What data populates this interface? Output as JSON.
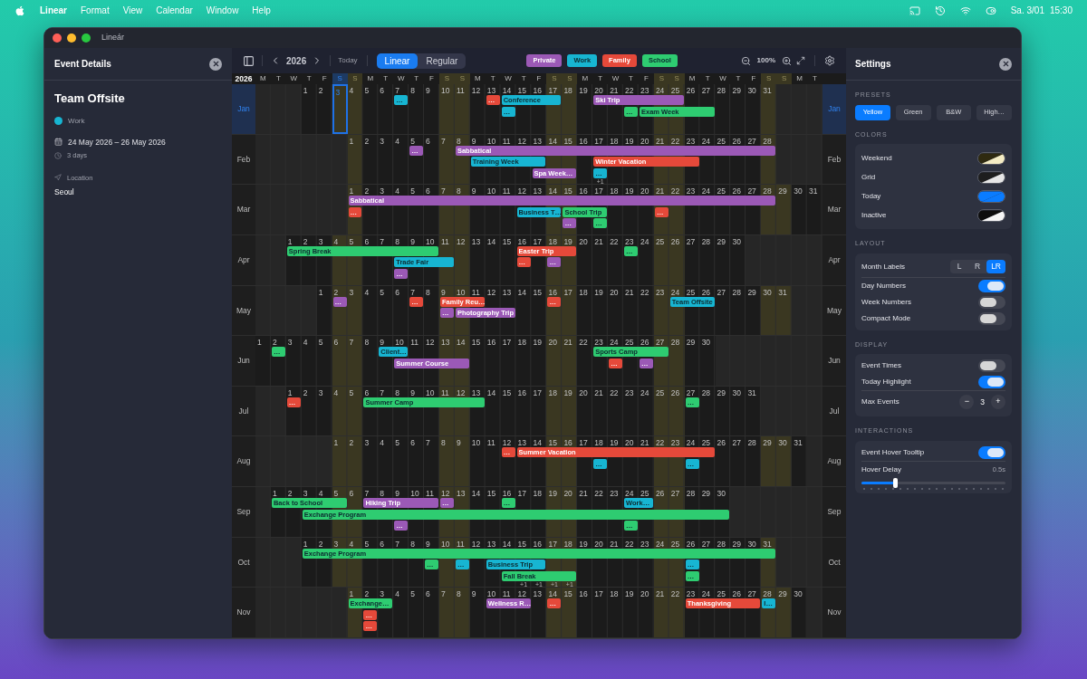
{
  "menu_bar": {
    "app": "Linear",
    "items": [
      "Format",
      "View",
      "Calendar",
      "Window",
      "Help"
    ],
    "date": "Sa. 3/01",
    "time": "15:30"
  },
  "window": {
    "title": "Lineár"
  },
  "event_details": {
    "title": "Event Details",
    "event_title": "Team Offsite",
    "category": {
      "label": "Work",
      "color": "#17b5d2"
    },
    "dates": "24 May 2026 – 26 May 2026",
    "duration": "3 days",
    "location_label": "Location",
    "location": "Seoul"
  },
  "toolbar": {
    "year": "2026",
    "today_button": "Today",
    "views": [
      {
        "label": "Linear",
        "selected": true
      },
      {
        "label": "Regular",
        "selected": false
      }
    ],
    "categories": [
      {
        "label": "Private",
        "color": "#9b59b6"
      },
      {
        "label": "Work",
        "color": "#17b5d2"
      },
      {
        "label": "Family",
        "color": "#e5493a"
      },
      {
        "label": "School",
        "color": "#2ecc71"
      }
    ],
    "zoom": "100%"
  },
  "calendar": {
    "year_label": "2026",
    "weekdays": [
      "M",
      "T",
      "W",
      "T",
      "F",
      "S",
      "S",
      "M",
      "T",
      "W",
      "T",
      "F",
      "S",
      "S",
      "M",
      "T",
      "W",
      "T",
      "F",
      "S",
      "S",
      "M",
      "T",
      "W",
      "T",
      "F",
      "S",
      "S",
      "M",
      "T",
      "W",
      "T",
      "F",
      "S",
      "S",
      "M",
      "T"
    ],
    "months": [
      {
        "label_left": "Jan",
        "label_right": "Jan",
        "selected": true,
        "days": [
          {
            "d": "1",
            "today": false
          },
          {
            "d": "2",
            "today": false
          },
          {
            "d": "3",
            "today": true
          },
          {
            "d": "4",
            "today": false
          },
          {
            "d": "5",
            "today": false
          },
          {
            "d": "6",
            "today": false
          },
          {
            "d": "7",
            "today": false
          },
          {
            "d": "8",
            "today": false
          },
          {
            "d": "9",
            "today": false
          },
          {
            "d": "10",
            "today": false
          },
          {
            "d": "11",
            "today": false
          },
          {
            "d": "12",
            "today": false
          },
          {
            "d": "13",
            "today": false
          },
          {
            "d": "14",
            "today": false
          },
          {
            "d": "15",
            "today": false
          },
          {
            "d": "16",
            "today": false
          },
          {
            "d": "17",
            "today": false
          },
          {
            "d": "18",
            "today": false
          },
          {
            "d": "19",
            "today": false
          },
          {
            "d": "20",
            "today": false
          },
          {
            "d": "21",
            "today": false
          },
          {
            "d": "22",
            "today": false
          },
          {
            "d": "23",
            "today": false
          },
          {
            "d": "24",
            "today": false
          },
          {
            "d": "25",
            "today": false
          },
          {
            "d": "26",
            "today": false
          },
          {
            "d": "27",
            "today": false
          },
          {
            "d": "28",
            "today": false
          },
          {
            "d": "29",
            "today": false
          },
          {
            "d": "30",
            "today": false
          },
          {
            "d": "31",
            "today": false
          }
        ],
        "events": [
          {
            "label": "…",
            "color": "#17b5d2"
          },
          {
            "label": "…",
            "color": "#e5493a"
          },
          {
            "label": "Conference",
            "color": "#17b5d2"
          },
          {
            "label": "…",
            "color": "#17b5d2"
          },
          {
            "label": "Ski Trip",
            "color": "#9b59b6"
          },
          {
            "label": "…",
            "color": "#2ecc71"
          },
          {
            "label": "Exam Week",
            "color": "#2ecc71"
          }
        ]
      },
      {
        "label_left": "Feb",
        "label_right": "Feb",
        "selected": false,
        "days": [
          {
            "d": "1",
            "today": false
          },
          {
            "d": "2",
            "today": false
          },
          {
            "d": "3",
            "today": false
          },
          {
            "d": "4",
            "today": false
          },
          {
            "d": "5",
            "today": false
          },
          {
            "d": "6",
            "today": false
          },
          {
            "d": "7",
            "today": false
          },
          {
            "d": "8",
            "today": false
          },
          {
            "d": "9",
            "today": false
          },
          {
            "d": "10",
            "today": false
          },
          {
            "d": "11",
            "today": false
          },
          {
            "d": "12",
            "today": false
          },
          {
            "d": "13",
            "today": false
          },
          {
            "d": "14",
            "today": false
          },
          {
            "d": "15",
            "today": false
          },
          {
            "d": "16",
            "today": false
          },
          {
            "d": "17",
            "today": false,
            "more": "+1"
          },
          {
            "d": "18",
            "today": false
          },
          {
            "d": "19",
            "today": false
          },
          {
            "d": "20",
            "today": false
          },
          {
            "d": "21",
            "today": false
          },
          {
            "d": "22",
            "today": false
          },
          {
            "d": "23",
            "today": false
          },
          {
            "d": "24",
            "today": false
          },
          {
            "d": "25",
            "today": false
          },
          {
            "d": "26",
            "today": false
          },
          {
            "d": "27",
            "today": false
          },
          {
            "d": "28",
            "today": false
          }
        ],
        "events": [
          {
            "label": "…",
            "color": "#9b59b6"
          },
          {
            "label": "Sabbatical",
            "color": "#9b59b6"
          },
          {
            "label": "Training Week",
            "color": "#17b5d2"
          },
          {
            "label": "Spa Week…",
            "color": "#9b59b6"
          },
          {
            "label": "Winter Vacation",
            "color": "#e5493a"
          },
          {
            "label": "…",
            "color": "#17b5d2"
          }
        ]
      },
      {
        "label_left": "Mar",
        "label_right": "Mar",
        "selected": false,
        "days": [
          {
            "d": "1",
            "today": false
          },
          {
            "d": "2",
            "today": false
          },
          {
            "d": "3",
            "today": false
          },
          {
            "d": "4",
            "today": false
          },
          {
            "d": "5",
            "today": false
          },
          {
            "d": "6",
            "today": false
          },
          {
            "d": "7",
            "today": false
          },
          {
            "d": "8",
            "today": false
          },
          {
            "d": "9",
            "today": false
          },
          {
            "d": "10",
            "today": false
          },
          {
            "d": "11",
            "today": false
          },
          {
            "d": "12",
            "today": false
          },
          {
            "d": "13",
            "today": false
          },
          {
            "d": "14",
            "today": false
          },
          {
            "d": "15",
            "today": false
          },
          {
            "d": "16",
            "today": false
          },
          {
            "d": "17",
            "today": false
          },
          {
            "d": "18",
            "today": false
          },
          {
            "d": "19",
            "today": false
          },
          {
            "d": "20",
            "today": false
          },
          {
            "d": "21",
            "today": false
          },
          {
            "d": "22",
            "today": false
          },
          {
            "d": "23",
            "today": false
          },
          {
            "d": "24",
            "today": false
          },
          {
            "d": "25",
            "today": false
          },
          {
            "d": "26",
            "today": false
          },
          {
            "d": "27",
            "today": false
          },
          {
            "d": "28",
            "today": false
          },
          {
            "d": "29",
            "today": false
          },
          {
            "d": "30",
            "today": false
          },
          {
            "d": "31",
            "today": false
          }
        ],
        "events": [
          {
            "label": "Sabbatical",
            "color": "#9b59b6"
          },
          {
            "label": "…",
            "color": "#e5493a"
          },
          {
            "label": "Business T…",
            "color": "#17b5d2"
          },
          {
            "label": "School Trip",
            "color": "#2ecc71"
          },
          {
            "label": "…",
            "color": "#9b59b6"
          },
          {
            "label": "…",
            "color": "#2ecc71"
          },
          {
            "label": "…",
            "color": "#e5493a"
          }
        ]
      },
      {
        "label_left": "Apr",
        "label_right": "Apr",
        "selected": false,
        "days": [
          {
            "d": "1",
            "today": false
          },
          {
            "d": "2",
            "today": false
          },
          {
            "d": "3",
            "today": false
          },
          {
            "d": "4",
            "today": false
          },
          {
            "d": "5",
            "today": false
          },
          {
            "d": "6",
            "today": false
          },
          {
            "d": "7",
            "today": false
          },
          {
            "d": "8",
            "today": false
          },
          {
            "d": "9",
            "today": false
          },
          {
            "d": "10",
            "today": false
          },
          {
            "d": "11",
            "today": false
          },
          {
            "d": "12",
            "today": false
          },
          {
            "d": "13",
            "today": false
          },
          {
            "d": "14",
            "today": false
          },
          {
            "d": "15",
            "today": false
          },
          {
            "d": "16",
            "today": false
          },
          {
            "d": "17",
            "today": false
          },
          {
            "d": "18",
            "today": false
          },
          {
            "d": "19",
            "today": false
          },
          {
            "d": "20",
            "today": false
          },
          {
            "d": "21",
            "today": false
          },
          {
            "d": "22",
            "today": false
          },
          {
            "d": "23",
            "today": false
          },
          {
            "d": "24",
            "today": false
          },
          {
            "d": "25",
            "today": false
          },
          {
            "d": "26",
            "today": false
          },
          {
            "d": "27",
            "today": false
          },
          {
            "d": "28",
            "today": false
          },
          {
            "d": "29",
            "today": false
          },
          {
            "d": "30",
            "today": false
          }
        ],
        "events": [
          {
            "label": "Spring Break",
            "color": "#2ecc71"
          },
          {
            "label": "Trade Fair",
            "color": "#17b5d2"
          },
          {
            "label": "…",
            "color": "#9b59b6"
          },
          {
            "label": "Easter Trip",
            "color": "#e5493a"
          },
          {
            "label": "…",
            "color": "#e5493a"
          },
          {
            "label": "…",
            "color": "#9b59b6"
          },
          {
            "label": "…",
            "color": "#2ecc71"
          }
        ]
      },
      {
        "label_left": "May",
        "label_right": "May",
        "selected": false,
        "days": [
          {
            "d": "1",
            "today": false
          },
          {
            "d": "2",
            "today": false
          },
          {
            "d": "3",
            "today": false
          },
          {
            "d": "4",
            "today": false
          },
          {
            "d": "5",
            "today": false
          },
          {
            "d": "6",
            "today": false
          },
          {
            "d": "7",
            "today": false
          },
          {
            "d": "8",
            "today": false
          },
          {
            "d": "9",
            "today": false
          },
          {
            "d": "10",
            "today": false
          },
          {
            "d": "11",
            "today": false
          },
          {
            "d": "12",
            "today": false
          },
          {
            "d": "13",
            "today": false
          },
          {
            "d": "14",
            "today": false
          },
          {
            "d": "15",
            "today": false
          },
          {
            "d": "16",
            "today": false
          },
          {
            "d": "17",
            "today": false
          },
          {
            "d": "18",
            "today": false
          },
          {
            "d": "19",
            "today": false
          },
          {
            "d": "20",
            "today": false
          },
          {
            "d": "21",
            "today": false
          },
          {
            "d": "22",
            "today": false
          },
          {
            "d": "23",
            "today": false
          },
          {
            "d": "24",
            "today": false
          },
          {
            "d": "25",
            "today": false
          },
          {
            "d": "26",
            "today": false
          },
          {
            "d": "27",
            "today": false
          },
          {
            "d": "28",
            "today": false
          },
          {
            "d": "29",
            "today": false
          },
          {
            "d": "30",
            "today": false
          },
          {
            "d": "31",
            "today": false
          }
        ],
        "events": [
          {
            "label": "…",
            "color": "#9b59b6"
          },
          {
            "label": "…",
            "color": "#e5493a"
          },
          {
            "label": "Family Reu…",
            "color": "#e5493a"
          },
          {
            "label": "…",
            "color": "#9b59b6"
          },
          {
            "label": "Photography Trip",
            "color": "#9b59b6"
          },
          {
            "label": "…",
            "color": "#e5493a"
          },
          {
            "label": "Team Offsite",
            "color": "#17b5d2"
          }
        ]
      },
      {
        "label_left": "Jun",
        "label_right": "Jun",
        "selected": false,
        "days": [
          {
            "d": "1",
            "today": false
          },
          {
            "d": "2",
            "today": false
          },
          {
            "d": "3",
            "today": false
          },
          {
            "d": "4",
            "today": false
          },
          {
            "d": "5",
            "today": false
          },
          {
            "d": "6",
            "today": false
          },
          {
            "d": "7",
            "today": false
          },
          {
            "d": "8",
            "today": false
          },
          {
            "d": "9",
            "today": false
          },
          {
            "d": "10",
            "today": false
          },
          {
            "d": "11",
            "today": false
          },
          {
            "d": "12",
            "today": false
          },
          {
            "d": "13",
            "today": false
          },
          {
            "d": "14",
            "today": false
          },
          {
            "d": "15",
            "today": false
          },
          {
            "d": "16",
            "today": false
          },
          {
            "d": "17",
            "today": false
          },
          {
            "d": "18",
            "today": false
          },
          {
            "d": "19",
            "today": false
          },
          {
            "d": "20",
            "today": false
          },
          {
            "d": "21",
            "today": false
          },
          {
            "d": "22",
            "today": false
          },
          {
            "d": "23",
            "today": false
          },
          {
            "d": "24",
            "today": false
          },
          {
            "d": "25",
            "today": false
          },
          {
            "d": "26",
            "today": false
          },
          {
            "d": "27",
            "today": false
          },
          {
            "d": "28",
            "today": false
          },
          {
            "d": "29",
            "today": false
          },
          {
            "d": "30",
            "today": false
          }
        ],
        "events": [
          {
            "label": "…",
            "color": "#2ecc71"
          },
          {
            "label": "Client…",
            "color": "#17b5d2"
          },
          {
            "label": "Summer Course",
            "color": "#9b59b6"
          },
          {
            "label": "Sports Camp",
            "color": "#2ecc71"
          },
          {
            "label": "…",
            "color": "#e5493a"
          },
          {
            "label": "…",
            "color": "#9b59b6"
          }
        ]
      },
      {
        "label_left": "Jul",
        "label_right": "Jul",
        "selected": false,
        "days": [
          {
            "d": "1",
            "today": false
          },
          {
            "d": "2",
            "today": false
          },
          {
            "d": "3",
            "today": false
          },
          {
            "d": "4",
            "today": false
          },
          {
            "d": "5",
            "today": false
          },
          {
            "d": "6",
            "today": false
          },
          {
            "d": "7",
            "today": false
          },
          {
            "d": "8",
            "today": false
          },
          {
            "d": "9",
            "today": false
          },
          {
            "d": "10",
            "today": false
          },
          {
            "d": "11",
            "today": false
          },
          {
            "d": "12",
            "today": false
          },
          {
            "d": "13",
            "today": false
          },
          {
            "d": "14",
            "today": false
          },
          {
            "d": "15",
            "today": false
          },
          {
            "d": "16",
            "today": false
          },
          {
            "d": "17",
            "today": false
          },
          {
            "d": "18",
            "today": false
          },
          {
            "d": "19",
            "today": false
          },
          {
            "d": "20",
            "today": false
          },
          {
            "d": "21",
            "today": false
          },
          {
            "d": "22",
            "today": false
          },
          {
            "d": "23",
            "today": false
          },
          {
            "d": "24",
            "today": false
          },
          {
            "d": "25",
            "today": false
          },
          {
            "d": "26",
            "today": false
          },
          {
            "d": "27",
            "today": false
          },
          {
            "d": "28",
            "today": false
          },
          {
            "d": "29",
            "today": false
          },
          {
            "d": "30",
            "today": false
          },
          {
            "d": "31",
            "today": false
          }
        ],
        "events": [
          {
            "label": "…",
            "color": "#e5493a"
          },
          {
            "label": "Summer Camp",
            "color": "#2ecc71"
          },
          {
            "label": "…",
            "color": "#2ecc71"
          }
        ]
      },
      {
        "label_left": "Aug",
        "label_right": "Aug",
        "selected": false,
        "days": [
          {
            "d": "1",
            "today": false
          },
          {
            "d": "2",
            "today": false
          },
          {
            "d": "3",
            "today": false
          },
          {
            "d": "4",
            "today": false
          },
          {
            "d": "5",
            "today": false
          },
          {
            "d": "6",
            "today": false
          },
          {
            "d": "7",
            "today": false
          },
          {
            "d": "8",
            "today": false
          },
          {
            "d": "9",
            "today": false
          },
          {
            "d": "10",
            "today": false
          },
          {
            "d": "11",
            "today": false
          },
          {
            "d": "12",
            "today": false
          },
          {
            "d": "13",
            "today": false
          },
          {
            "d": "14",
            "today": false
          },
          {
            "d": "15",
            "today": false
          },
          {
            "d": "16",
            "today": false
          },
          {
            "d": "17",
            "today": false
          },
          {
            "d": "18",
            "today": false
          },
          {
            "d": "19",
            "today": false
          },
          {
            "d": "20",
            "today": false
          },
          {
            "d": "21",
            "today": false
          },
          {
            "d": "22",
            "today": false
          },
          {
            "d": "23",
            "today": false
          },
          {
            "d": "24",
            "today": false
          },
          {
            "d": "25",
            "today": false
          },
          {
            "d": "26",
            "today": false
          },
          {
            "d": "27",
            "today": false
          },
          {
            "d": "28",
            "today": false
          },
          {
            "d": "29",
            "today": false
          },
          {
            "d": "30",
            "today": false
          },
          {
            "d": "31",
            "today": false
          }
        ],
        "events": [
          {
            "label": "…",
            "color": "#e5493a"
          },
          {
            "label": "Summer Vacation",
            "color": "#e5493a"
          },
          {
            "label": "…",
            "color": "#17b5d2"
          },
          {
            "label": "…",
            "color": "#17b5d2"
          }
        ]
      },
      {
        "label_left": "Sep",
        "label_right": "Sep",
        "selected": false,
        "days": [
          {
            "d": "1",
            "today": false
          },
          {
            "d": "2",
            "today": false
          },
          {
            "d": "3",
            "today": false
          },
          {
            "d": "4",
            "today": false
          },
          {
            "d": "5",
            "today": false
          },
          {
            "d": "6",
            "today": false
          },
          {
            "d": "7",
            "today": false
          },
          {
            "d": "8",
            "today": false
          },
          {
            "d": "9",
            "today": false
          },
          {
            "d": "10",
            "today": false
          },
          {
            "d": "11",
            "today": false
          },
          {
            "d": "12",
            "today": false
          },
          {
            "d": "13",
            "today": false
          },
          {
            "d": "14",
            "today": false
          },
          {
            "d": "15",
            "today": false
          },
          {
            "d": "16",
            "today": false
          },
          {
            "d": "17",
            "today": false
          },
          {
            "d": "18",
            "today": false
          },
          {
            "d": "19",
            "today": false
          },
          {
            "d": "20",
            "today": false
          },
          {
            "d": "21",
            "today": false
          },
          {
            "d": "22",
            "today": false
          },
          {
            "d": "23",
            "today": false
          },
          {
            "d": "24",
            "today": false
          },
          {
            "d": "25",
            "today": false
          },
          {
            "d": "26",
            "today": false
          },
          {
            "d": "27",
            "today": false
          },
          {
            "d": "28",
            "today": false
          },
          {
            "d": "29",
            "today": false
          },
          {
            "d": "30",
            "today": false
          }
        ],
        "events": [
          {
            "label": "Back to School",
            "color": "#2ecc71"
          },
          {
            "label": "Exchange Program",
            "color": "#2ecc71"
          },
          {
            "label": "Hiking Trip",
            "color": "#9b59b6"
          },
          {
            "label": "…",
            "color": "#9b59b6"
          },
          {
            "label": "…",
            "color": "#2ecc71"
          },
          {
            "label": "Work…",
            "color": "#17b5d2"
          },
          {
            "label": "…",
            "color": "#9b59b6"
          },
          {
            "label": "…",
            "color": "#2ecc71"
          }
        ]
      },
      {
        "label_left": "Oct",
        "label_right": "Oct",
        "selected": false,
        "days": [
          {
            "d": "1",
            "today": false
          },
          {
            "d": "2",
            "today": false
          },
          {
            "d": "3",
            "today": false
          },
          {
            "d": "4",
            "today": false
          },
          {
            "d": "5",
            "today": false
          },
          {
            "d": "6",
            "today": false
          },
          {
            "d": "7",
            "today": false
          },
          {
            "d": "8",
            "today": false
          },
          {
            "d": "9",
            "today": false
          },
          {
            "d": "10",
            "today": false
          },
          {
            "d": "11",
            "today": false
          },
          {
            "d": "12",
            "today": false
          },
          {
            "d": "13",
            "today": false
          },
          {
            "d": "14",
            "today": false
          },
          {
            "d": "15",
            "today": false,
            "more": "+1"
          },
          {
            "d": "16",
            "today": false,
            "more": "+1"
          },
          {
            "d": "17",
            "today": false,
            "more": "+1"
          },
          {
            "d": "18",
            "today": false,
            "more": "+1"
          },
          {
            "d": "19",
            "today": false
          },
          {
            "d": "20",
            "today": false
          },
          {
            "d": "21",
            "today": false
          },
          {
            "d": "22",
            "today": false
          },
          {
            "d": "23",
            "today": false
          },
          {
            "d": "24",
            "today": false
          },
          {
            "d": "25",
            "today": false
          },
          {
            "d": "26",
            "today": false
          },
          {
            "d": "27",
            "today": false
          },
          {
            "d": "28",
            "today": false
          },
          {
            "d": "29",
            "today": false
          },
          {
            "d": "30",
            "today": false
          },
          {
            "d": "31",
            "today": false
          }
        ],
        "events": [
          {
            "label": "Exchange Program",
            "color": "#2ecc71"
          },
          {
            "label": "…",
            "color": "#2ecc71"
          },
          {
            "label": "…",
            "color": "#17b5d2"
          },
          {
            "label": "Business Trip",
            "color": "#17b5d2"
          },
          {
            "label": "Fall Break",
            "color": "#2ecc71"
          },
          {
            "label": "…",
            "color": "#17b5d2"
          },
          {
            "label": "…",
            "color": "#2ecc71"
          }
        ]
      },
      {
        "label_left": "Nov",
        "label_right": "Nov",
        "selected": false,
        "days": [
          {
            "d": "1",
            "today": false
          },
          {
            "d": "2",
            "today": false
          },
          {
            "d": "3",
            "today": false
          },
          {
            "d": "4",
            "today": false
          },
          {
            "d": "5",
            "today": false
          },
          {
            "d": "6",
            "today": false
          },
          {
            "d": "7",
            "today": false
          },
          {
            "d": "8",
            "today": false
          },
          {
            "d": "9",
            "today": false
          },
          {
            "d": "10",
            "today": false
          },
          {
            "d": "11",
            "today": false
          },
          {
            "d": "12",
            "today": false
          },
          {
            "d": "13",
            "today": false
          },
          {
            "d": "14",
            "today": false
          },
          {
            "d": "15",
            "today": false
          },
          {
            "d": "16",
            "today": false
          },
          {
            "d": "17",
            "today": false
          },
          {
            "d": "18",
            "today": false
          },
          {
            "d": "19",
            "today": false
          },
          {
            "d": "20",
            "today": false
          },
          {
            "d": "21",
            "today": false
          },
          {
            "d": "22",
            "today": false
          },
          {
            "d": "23",
            "today": false
          },
          {
            "d": "24",
            "today": false
          },
          {
            "d": "25",
            "today": false
          },
          {
            "d": "26",
            "today": false
          },
          {
            "d": "27",
            "today": false
          },
          {
            "d": "28",
            "today": false
          },
          {
            "d": "29",
            "today": false
          },
          {
            "d": "30",
            "today": false
          }
        ],
        "events": [
          {
            "label": "Exchange…",
            "color": "#2ecc71"
          },
          {
            "label": "…",
            "color": "#e5493a"
          },
          {
            "label": "…",
            "color": "#e5493a"
          },
          {
            "label": "Wellness R…",
            "color": "#9b59b6"
          },
          {
            "label": "…",
            "color": "#e5493a"
          },
          {
            "label": "Thanksgiving",
            "color": "#e5493a"
          },
          {
            "label": "I…",
            "color": "#17b5d2"
          }
        ]
      }
    ]
  },
  "settings": {
    "title": "Settings",
    "presets": {
      "heading": "PRESETS",
      "items": [
        {
          "label": "Yellow",
          "selected": true
        },
        {
          "label": "Green",
          "selected": false
        },
        {
          "label": "B&W",
          "selected": false
        },
        {
          "label": "High…",
          "selected": false
        }
      ]
    },
    "colors": {
      "heading": "COLORS",
      "items": [
        {
          "label": "Weekend",
          "halves": [
            {
              "color": "#2f2a10"
            },
            {
              "color": "#f4ecc4"
            }
          ]
        },
        {
          "label": "Grid",
          "halves": [
            {
              "color": "#1e1e1e"
            },
            {
              "color": "#e6e6e6"
            }
          ]
        },
        {
          "label": "Today",
          "halves": [
            {
              "color": "#0a7cff"
            },
            {
              "color": "#0a7cff"
            }
          ]
        },
        {
          "label": "Inactive",
          "halves": [
            {
              "color": "#0d0d0d"
            },
            {
              "color": "#f5f5f5"
            }
          ]
        }
      ]
    },
    "sections": [
      {
        "heading": "LAYOUT",
        "items": [
          {
            "kind": "segmented",
            "label": "Month Labels",
            "options": [
              {
                "label": "L",
                "selected": false
              },
              {
                "label": "R",
                "selected": false
              },
              {
                "label": "LR",
                "selected": true
              }
            ]
          },
          {
            "kind": "toggle",
            "label": "Day Numbers",
            "on": true
          },
          {
            "kind": "toggle",
            "label": "Week Numbers",
            "on": false
          },
          {
            "kind": "toggle",
            "label": "Compact Mode",
            "on": false
          }
        ]
      },
      {
        "heading": "DISPLAY",
        "items": [
          {
            "kind": "toggle",
            "label": "Event Times",
            "on": false
          },
          {
            "kind": "toggle",
            "label": "Today Highlight",
            "on": true
          },
          {
            "kind": "stepper",
            "label": "Max Events",
            "minus": "−",
            "value": "3",
            "plus": "+"
          }
        ]
      },
      {
        "heading": "INTERACTIONS",
        "items": [
          {
            "kind": "toggle",
            "label": "Event Hover Tooltip",
            "on": true
          },
          {
            "kind": "slider",
            "label": "Hover Delay",
            "reading": "0.5s",
            "level": 0.23
          }
        ]
      }
    ]
  }
}
